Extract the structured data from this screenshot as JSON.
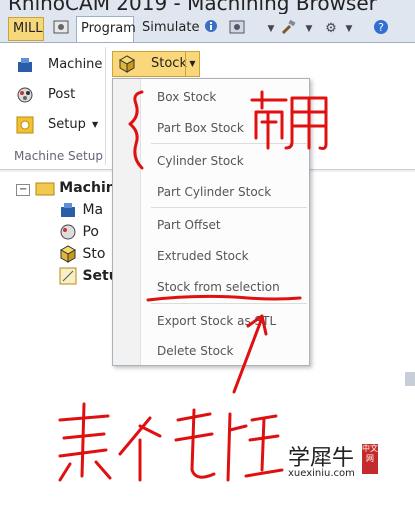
{
  "window": {
    "title": "RhinoCAM 2019 - Machining Browser"
  },
  "tabs": {
    "mill": "MILL",
    "program": "Program",
    "simulate": "Simulate"
  },
  "ribbon": {
    "machine_label": "Machine",
    "post_label": "Post",
    "setup_label": "Setup",
    "group_label": "Machine Setup",
    "stock_label": "Stock"
  },
  "stock_menu": {
    "items": [
      "Box Stock",
      "Part Box Stock",
      "Cylinder Stock",
      "Part Cylinder Stock",
      "Part Offset",
      "Extruded Stock",
      "Stock from selection",
      "Export Stock as STL",
      "Delete Stock"
    ]
  },
  "tree": {
    "root": "Machin",
    "children": [
      "Ma",
      "Po",
      "Sto",
      "Setu"
    ]
  },
  "watermark": {
    "name": "学犀牛",
    "site": "xuexiniu.com",
    "stamp": "中文网"
  },
  "colors": {
    "accent": "#f9d77a",
    "ink": "#e01010",
    "ribbon_bg": "#dfe6ef"
  }
}
